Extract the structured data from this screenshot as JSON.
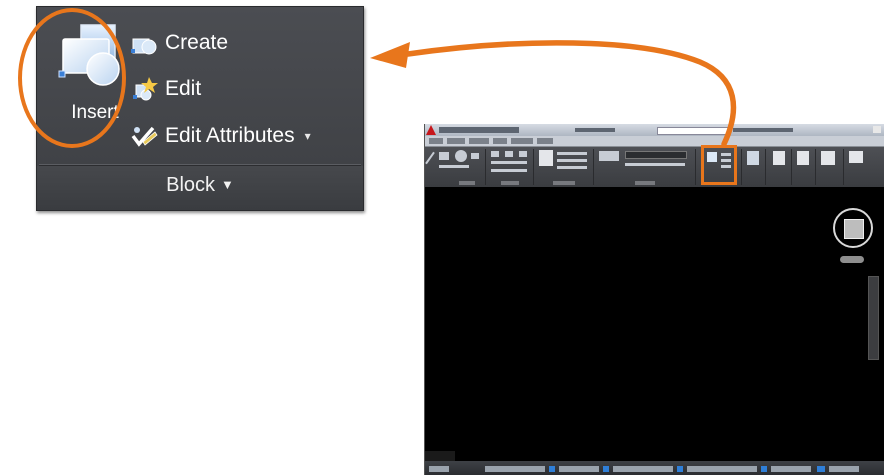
{
  "block_panel": {
    "insert_label": "Insert",
    "create_label": "Create",
    "edit_label": "Edit",
    "edit_attributes_label": "Edit Attributes",
    "dropdown_glyph": "▾",
    "panel_title": "Block",
    "panel_caret": "▼"
  },
  "icons": {
    "insert": "insert-block-icon",
    "create": "create-block-icon",
    "edit": "block-editor-icon",
    "edit_attributes": "edit-attributes-icon"
  },
  "colors": {
    "highlight": "#e8761c",
    "ribbon_dark": "#3d3f43",
    "canvas": "#000000"
  }
}
